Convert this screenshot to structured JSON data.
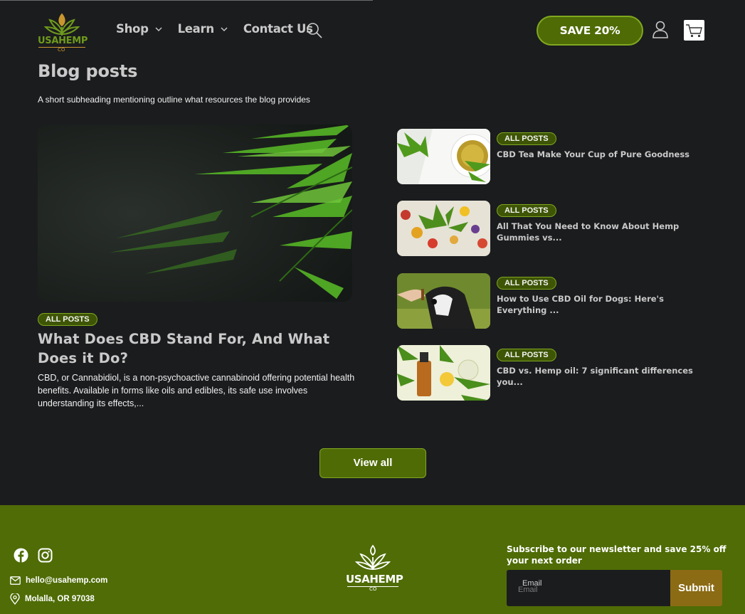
{
  "header": {
    "logo_text": "USAHEMP",
    "logo_sub": "CO",
    "nav": [
      {
        "label": "Shop"
      },
      {
        "label": "Learn"
      },
      {
        "label": "Contact Us"
      }
    ],
    "save_label": "SAVE 20%",
    "icons": [
      "search-icon",
      "account-icon",
      "cart-icon"
    ]
  },
  "blog": {
    "title": "Blog posts",
    "subheading": "A short subheading mentioning outline what resources the blog provides",
    "featured": {
      "tag": "ALL POSTS",
      "title": "What Does CBD Stand For, And What Does it Do?",
      "excerpt": "CBD, or Cannabidiol, is a non-psychoactive cannabinoid offering potential health benefits. Available in forms like oils and edibles, its safe use involves understanding its effects,..."
    },
    "posts": [
      {
        "tag": "ALL POSTS",
        "title": "CBD Tea Make Your Cup of Pure Goodness"
      },
      {
        "tag": "ALL POSTS",
        "title": "All That You Need to Know About Hemp Gummies vs..."
      },
      {
        "tag": "ALL POSTS",
        "title": "How to Use CBD Oil for Dogs: Here's Everything ..."
      },
      {
        "tag": "ALL POSTS",
        "title": "CBD vs. Hemp oil: 7 significant differences you..."
      }
    ],
    "view_all": "View all"
  },
  "footer": {
    "email": "hello@usahemp.com",
    "location": "Molalla, OR 97038",
    "logo_text": "USAHEMP",
    "logo_sub": "CO",
    "newsletter_title": "Subscribe to our newsletter and save 25% off your next order",
    "email_label": "Email",
    "email_placeholder": "Email",
    "submit_label": "Submit",
    "social": [
      "facebook-icon",
      "instagram-icon"
    ]
  },
  "colors": {
    "background": "#1b1c1e",
    "accent_green": "#4f6b06",
    "accent_border": "#7fa81f",
    "footer_green": "#4f6c06",
    "submit_gold": "#8b6b14"
  }
}
